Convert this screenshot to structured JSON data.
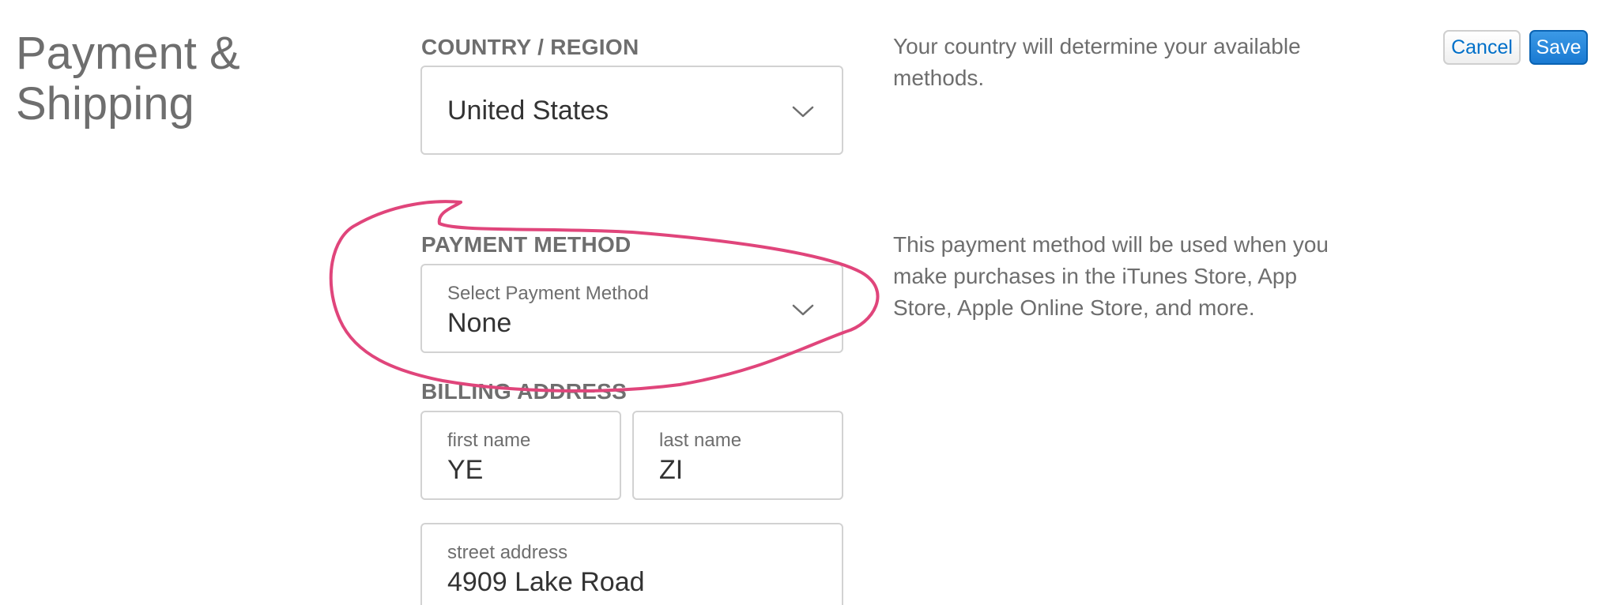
{
  "page": {
    "title": "Payment & Shipping"
  },
  "toolbar": {
    "cancel_label": "Cancel",
    "save_label": "Save"
  },
  "country": {
    "section_label": "COUNTRY / REGION",
    "value": "United States",
    "description": "Your country will determine your available methods."
  },
  "payment": {
    "section_label": "PAYMENT METHOD",
    "field_label": "Select Payment Method",
    "value": "None",
    "description": "This payment method will be used when you make purchases in the iTunes Store, App Store, Apple Online Store, and more."
  },
  "billing": {
    "section_label": "BILLING ADDRESS",
    "first_name": {
      "label": "first name",
      "value": "YE"
    },
    "last_name": {
      "label": "last name",
      "value": "ZI"
    },
    "street": {
      "label": "street address",
      "value": "4909 Lake Road"
    }
  },
  "colors": {
    "accent": "#0070c9",
    "annotation": "#e0457b",
    "label_gray": "#6e6e6e",
    "border": "#d2d2d2"
  },
  "icons": {
    "country_dropdown": "chevron-down-icon",
    "payment_dropdown": "chevron-down-icon"
  }
}
